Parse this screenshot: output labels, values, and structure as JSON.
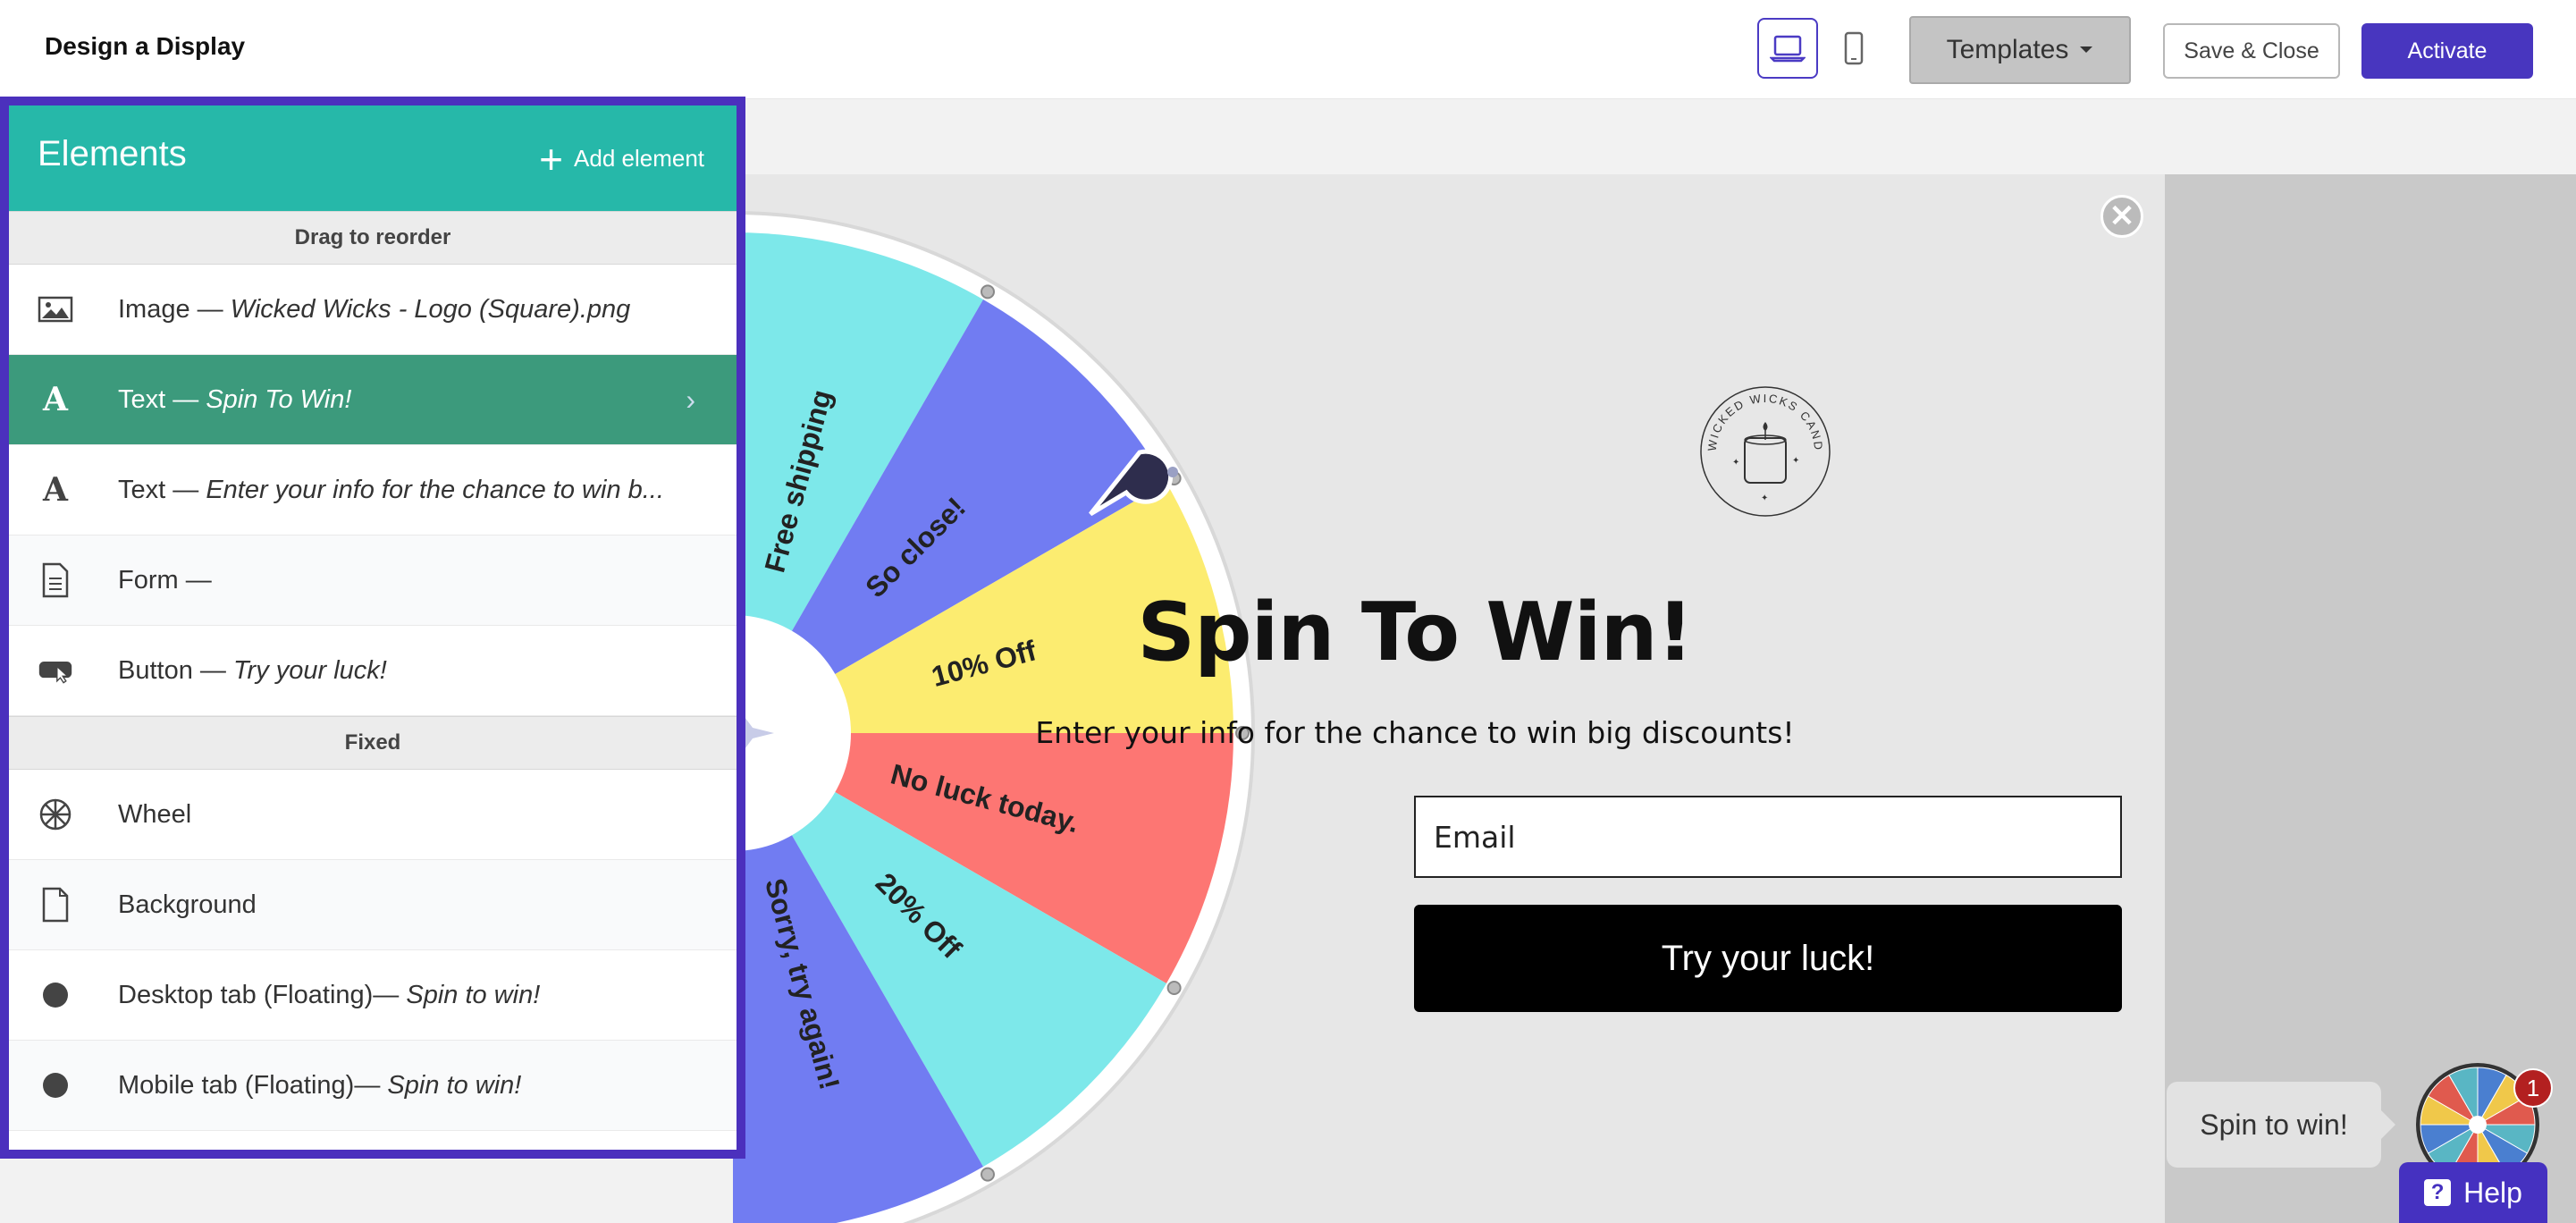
{
  "header": {
    "title": "Design a Display",
    "templates_label": "Templates",
    "save_close_label": "Save & Close",
    "activate_label": "Activate"
  },
  "panel": {
    "title": "Elements",
    "add_label": "Add element",
    "section_reorder": "Drag to reorder",
    "section_fixed": "Fixed",
    "reorder_items": [
      {
        "icon": "image-icon",
        "label": "Image — ",
        "detail": "Wicked Wicks - Logo (Square).png"
      },
      {
        "icon": "text-icon",
        "label": "Text — ",
        "detail": "Spin To Win!",
        "selected": true
      },
      {
        "icon": "text-icon",
        "label": "Text — ",
        "detail": "Enter your info for the chance to win b..."
      },
      {
        "icon": "form-icon",
        "label": "Form —",
        "detail": ""
      },
      {
        "icon": "button-icon",
        "label": "Button — ",
        "detail": "Try your luck!"
      }
    ],
    "fixed_items": [
      {
        "icon": "wheel-icon",
        "label": "Wheel",
        "detail": ""
      },
      {
        "icon": "page-icon",
        "label": "Background",
        "detail": ""
      },
      {
        "icon": "dot-icon",
        "label": "Desktop tab (Floating)— ",
        "detail": "Spin to win!"
      },
      {
        "icon": "dot-icon",
        "label": "Mobile tab (Floating)— ",
        "detail": "Spin to win!"
      }
    ]
  },
  "wheel": {
    "slices": [
      "Free shipping",
      "So close!",
      "10% Off",
      "No luck today.",
      "20% Off",
      "Sorry, try again!"
    ],
    "colors": [
      "#7de8ea",
      "#717cf2",
      "#fcec70",
      "#fd7673",
      "#7de8ea",
      "#717cf2"
    ]
  },
  "popup": {
    "heading": "Spin To Win!",
    "subtext": "Enter your info for the chance to win big discounts!",
    "email_placeholder": "Email",
    "button_label": "Try your luck!",
    "logo_text": "WICKED WICKS CANDLE CO."
  },
  "floating": {
    "tab_label": "Spin to win!",
    "badge_count": "1",
    "help_label": "Help"
  },
  "colors": {
    "accent": "#4836bf",
    "panel_header": "#26b8a9",
    "selected_row": "#3c9a7c"
  }
}
